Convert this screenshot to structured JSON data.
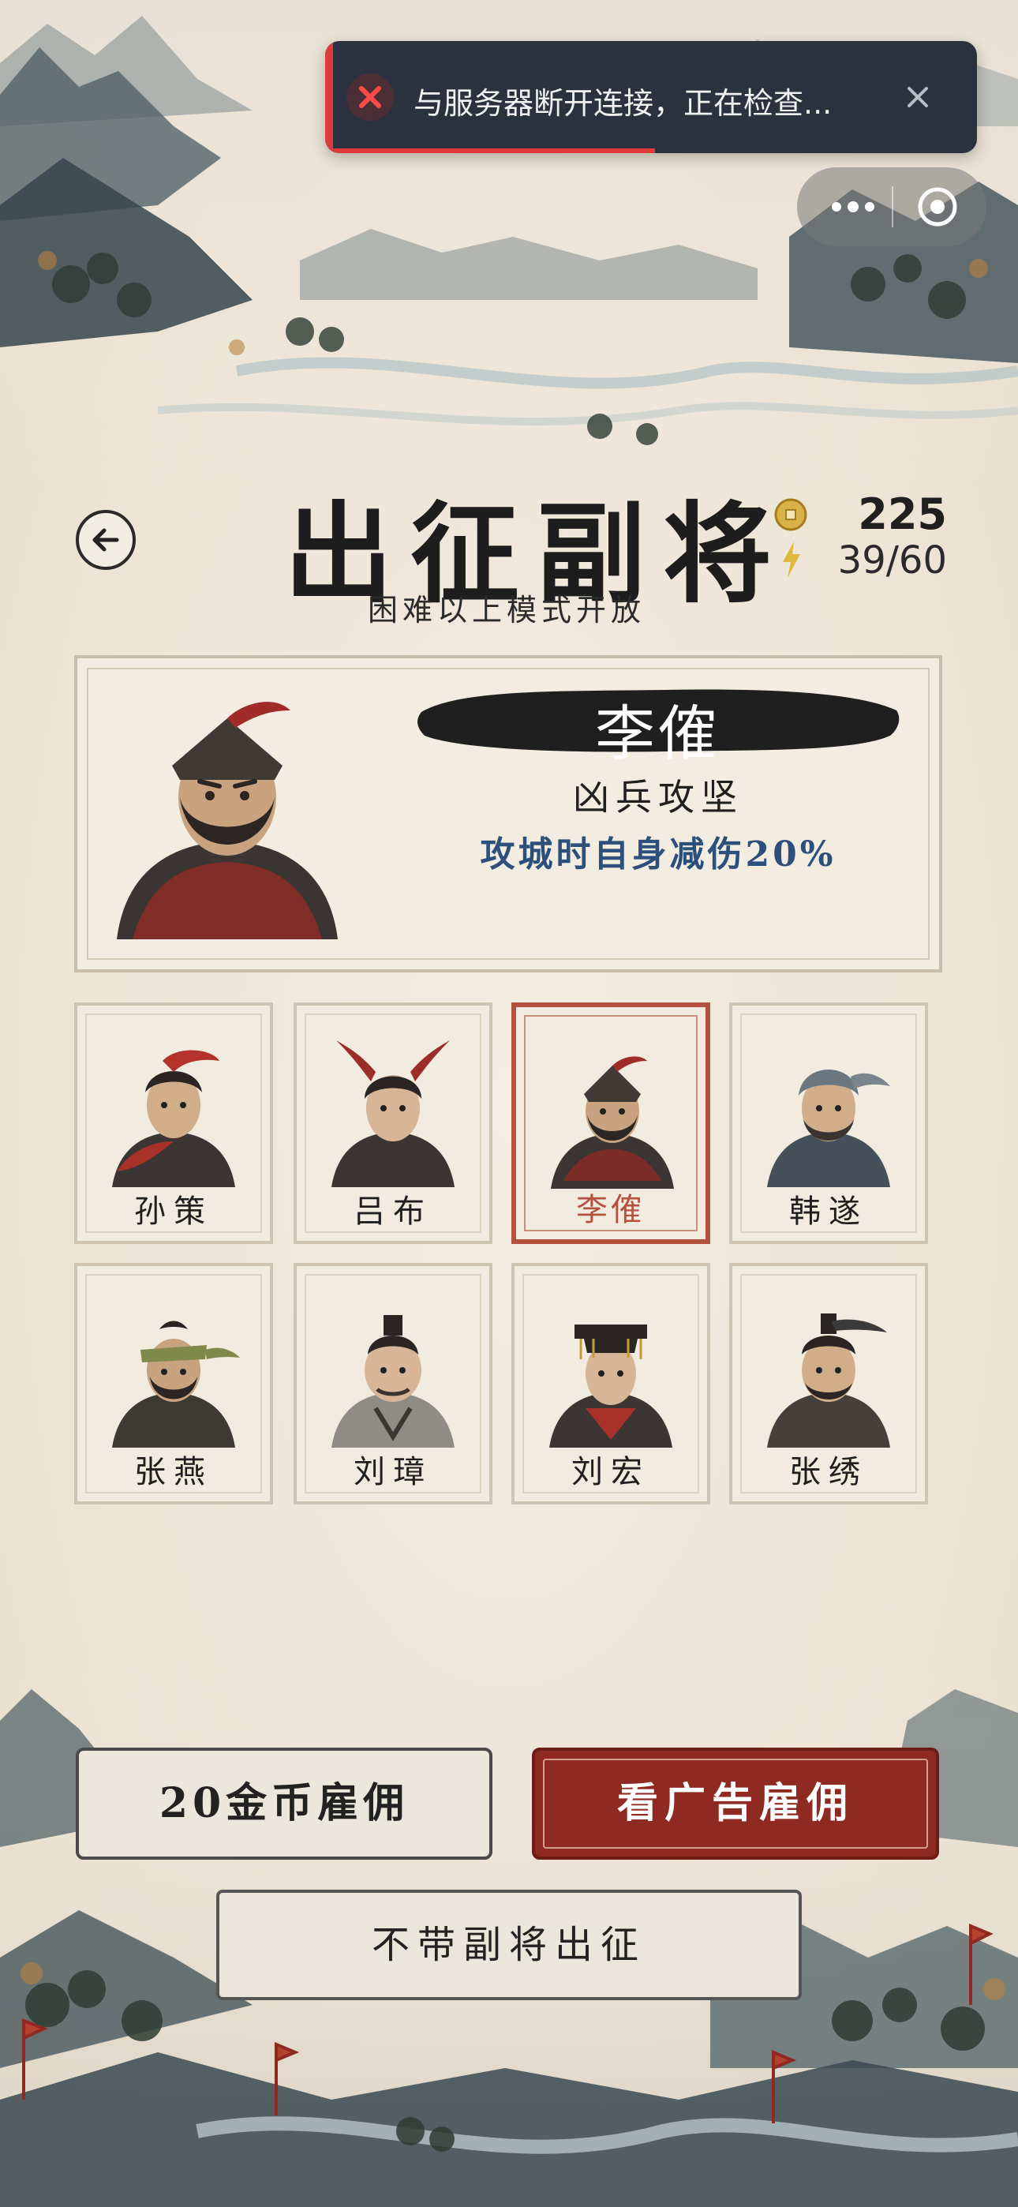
{
  "toast": {
    "message": "与服务器断开连接，正在检查...",
    "progress": 0.5,
    "colors": {
      "background": "#2c3140",
      "accent": "#e03b3b"
    },
    "icons": {
      "status": "error-x-icon",
      "close": "close-icon"
    }
  },
  "capsule": {
    "icons": [
      "more-dots-icon",
      "target-icon"
    ]
  },
  "header": {
    "title": "出征副将",
    "subtitle": "困难以上模式开放",
    "coins": "225",
    "energy": "39/60",
    "icons": {
      "back": "back-arrow-icon",
      "coin": "coin-icon",
      "energy": "lightning-icon"
    }
  },
  "selected": {
    "name": "李傕",
    "skill_name": "凶兵攻坚",
    "skill_desc": "攻城时自身减伤20%"
  },
  "generals": [
    {
      "name": "孙策"
    },
    {
      "name": "吕布"
    },
    {
      "name": "李傕",
      "selected": true
    },
    {
      "name": "韩遂"
    },
    {
      "name": "张燕"
    },
    {
      "name": "刘璋"
    },
    {
      "name": "刘宏"
    },
    {
      "name": "张绣"
    }
  ],
  "actions": {
    "hire_gold": "20金币雇佣",
    "hire_ad": "看广告雇佣",
    "no_general": "不带副将出征"
  },
  "colors": {
    "accent_red": "#8f2a22",
    "selected_border": "#b5523f",
    "skill_blue": "#2c4f7c"
  }
}
